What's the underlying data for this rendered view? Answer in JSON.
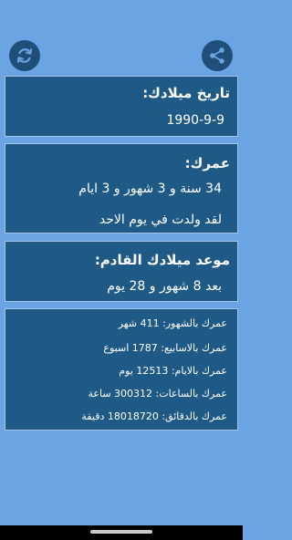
{
  "colors": {
    "background": "#6aa4e2",
    "card": "#1f5a86",
    "card_border": "#a7c4e8",
    "icon_button": "#1f4e79",
    "text": "#ffffff"
  },
  "toolbar": {
    "refresh_icon": "refresh-icon",
    "share_icon": "share-icon"
  },
  "birth": {
    "title": "تاريخ ميلادك:",
    "date": "1990-9-9"
  },
  "age": {
    "title": "عمرك:",
    "value": "34 سنة و 3 شهور و 3 ايام",
    "weekday": "لقد ولدت في يوم الاحد"
  },
  "next_birthday": {
    "title": "موعد ميلادك القادم:",
    "value": "بعد 8 شهور و 28 يوم"
  },
  "stats": {
    "months": "عمرك بالشهور: 411 شهر",
    "weeks": "عمرك بالاسابيع: 1787 اسبوع",
    "days": "عمرك بالايام: 12513 يوم",
    "hours": "عمرك بالساعات: 300312 ساعة",
    "minutes": "عمرك بالدقائق: 18018720 دقيقة"
  }
}
